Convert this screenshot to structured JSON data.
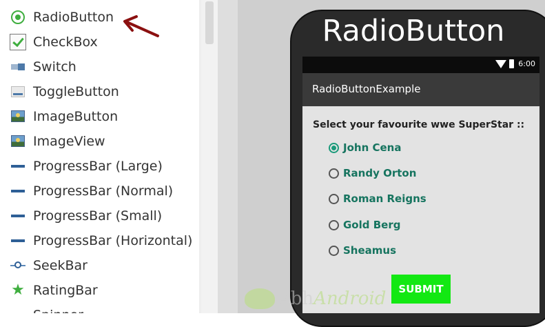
{
  "palette": {
    "items": [
      {
        "label": "RadioButton",
        "icon": "radio-button-icon"
      },
      {
        "label": "CheckBox",
        "icon": "checkbox-icon"
      },
      {
        "label": "Switch",
        "icon": "switch-icon"
      },
      {
        "label": "ToggleButton",
        "icon": "toggle-button-icon"
      },
      {
        "label": "ImageButton",
        "icon": "image-button-icon"
      },
      {
        "label": "ImageView",
        "icon": "image-view-icon"
      },
      {
        "label": "ProgressBar (Large)",
        "icon": "progress-bar-icon"
      },
      {
        "label": "ProgressBar (Normal)",
        "icon": "progress-bar-icon"
      },
      {
        "label": "ProgressBar (Small)",
        "icon": "progress-bar-icon"
      },
      {
        "label": "ProgressBar (Horizontal)",
        "icon": "progress-bar-icon"
      },
      {
        "label": "SeekBar",
        "icon": "seekbar-icon"
      },
      {
        "label": "RatingBar",
        "icon": "star-icon"
      },
      {
        "label": "Spinner",
        "icon": "spinner-icon"
      }
    ]
  },
  "preview": {
    "overlay_title": "RadioButton",
    "status_time": "6:00",
    "app_title": "RadioButtonExample",
    "question": "Select your favourite wwe SuperStar ::",
    "options": [
      {
        "label": "John Cena",
        "checked": true
      },
      {
        "label": "Randy Orton",
        "checked": false
      },
      {
        "label": "Roman Reigns",
        "checked": false
      },
      {
        "label": "Gold Berg",
        "checked": false
      },
      {
        "label": "Sheamus",
        "checked": false
      }
    ],
    "submit_label": "SUBMIT",
    "watermark": {
      "part1": "Abh",
      "part2": "Android"
    }
  },
  "colors": {
    "accent_green": "#3fae3f",
    "radio_checked": "#1a9a7a",
    "submit_bg": "#13e813",
    "arrow": "#8b1010"
  }
}
